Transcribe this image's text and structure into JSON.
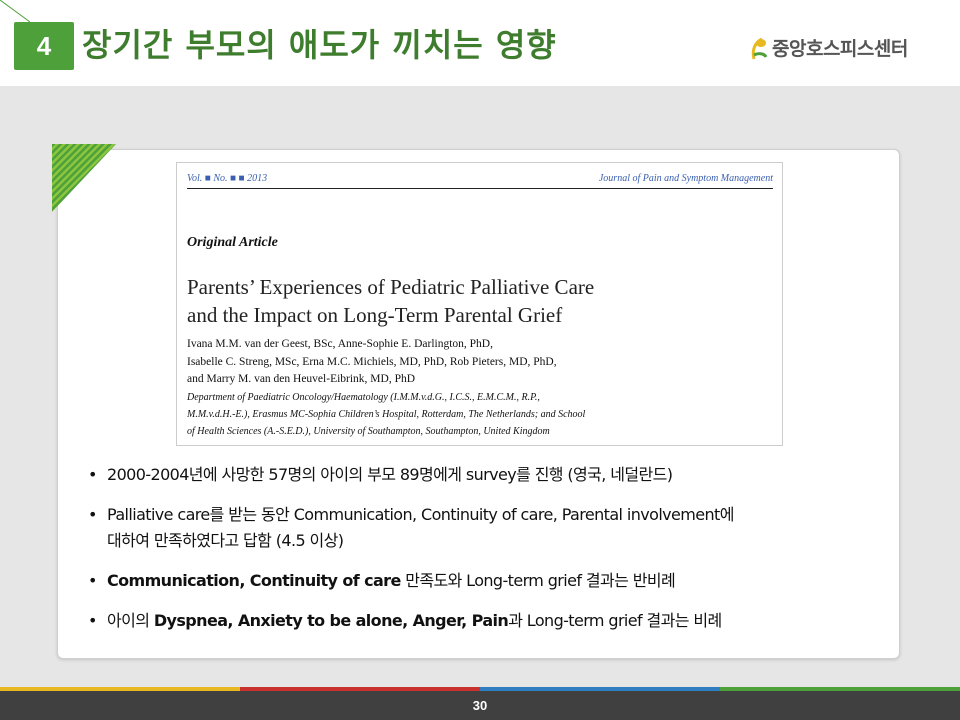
{
  "slide": {
    "number": "4",
    "title": "장기간 부모의 애도가 끼치는 영향",
    "logo_text": "중앙호스피스센터",
    "page_number": "30"
  },
  "article": {
    "volume": "Vol. ■ No. ■ ■ 2013",
    "journal": "Journal of Pain and Symptom Management",
    "type": "Original Article",
    "title_line1": "Parents’ Experiences of Pediatric Palliative Care",
    "title_line2": "and the Impact on Long-Term Parental Grief",
    "authors_line1": "Ivana M.M. van der Geest, BSc, Anne-Sophie E. Darlington, PhD,",
    "authors_line2": "Isabelle C. Streng, MSc, Erna M.C. Michiels, MD, PhD, Rob Pieters, MD, PhD,",
    "authors_line3": "and Marry M. van den Heuvel-Eibrink, MD, PhD",
    "dept_line1": "Department of Paediatric Oncology/Haematology (I.M.M.v.d.G., I.C.S., E.M.C.M., R.P.,",
    "dept_line2": "M.M.v.d.H.-E.), Erasmus MC-Sophia Children’s Hospital, Rotterdam, The Netherlands; and School",
    "dept_line3": "of Health Sciences (A.-S.E.D.), University of Southampton, Southampton, United Kingdom"
  },
  "bullets": {
    "b1": "2000-2004년에 사망한 57명의 아이의 부모 89명에게 survey를 진행 (영국, 네덜란드)",
    "b2_line1": "Palliative care를 받는 동안 Communication, Continuity of care, Parental involvement에",
    "b2_line2": "대하여 만족하였다고 답함 (4.5 이상)",
    "b3_bold": "Communication, Continuity of care",
    "b3_rest": " 만족도와 Long-term grief 결과는 반비례",
    "b4_pre": "아이의 ",
    "b4_bold": "Dyspnea, Anxiety to be alone, Anger, Pain",
    "b4_rest": "과 Long-term grief  결과는 비례"
  },
  "colors": {
    "accent_green": "#4ea03a",
    "title_green": "#3f7d2e",
    "footer_bar": "#404040",
    "footer_yellow": "#e8b820",
    "footer_red": "#c8312e",
    "footer_blue": "#2f7ec1",
    "footer_green": "#4ea03a"
  }
}
